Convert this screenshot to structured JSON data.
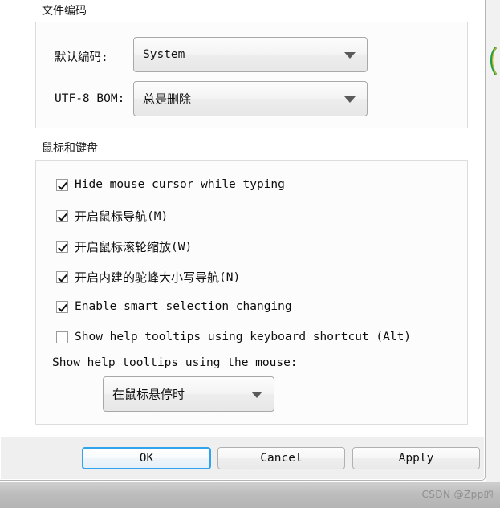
{
  "sections": [
    {
      "title": "文件编码",
      "rows": [
        {
          "label": "默认编码:",
          "value": "System",
          "cjk_value": false
        },
        {
          "label": "UTF-8 BOM:",
          "value": "总是删除",
          "cjk_value": true
        }
      ]
    },
    {
      "title": "鼠标和键盘",
      "checkboxes": [
        {
          "label": "Hide mouse cursor while typing",
          "checked": true,
          "cjk": false,
          "mnemonic": ""
        },
        {
          "label": "开启鼠标导航",
          "checked": true,
          "cjk": true,
          "mnemonic": "(M)"
        },
        {
          "label": "开启鼠标滚轮缩放",
          "checked": true,
          "cjk": true,
          "mnemonic": "(W)"
        },
        {
          "label": "开启内建的驼峰大小写导航",
          "checked": true,
          "cjk": true,
          "mnemonic": "(N)"
        },
        {
          "label": "Enable smart selection changing",
          "checked": true,
          "cjk": false,
          "mnemonic": ""
        },
        {
          "label": "Show help tooltips using keyboard shortcut (Alt)",
          "checked": false,
          "cjk": false,
          "mnemonic": ""
        }
      ],
      "tooltip_mouse_label": "Show help tooltips using the mouse:",
      "tooltip_mouse_value": "在鼠标悬停时"
    }
  ],
  "footer": {
    "ok_label": "OK",
    "cancel_label": "Cancel",
    "apply_label": "Apply"
  },
  "watermark": "CSDN @Zpp的",
  "colors": {
    "accent": "#2fa3ec",
    "dialog_bg": "#ffffff",
    "footer_bg": "#efefef",
    "group_border": "#dcdcdc",
    "text": "#0d0d0d"
  }
}
